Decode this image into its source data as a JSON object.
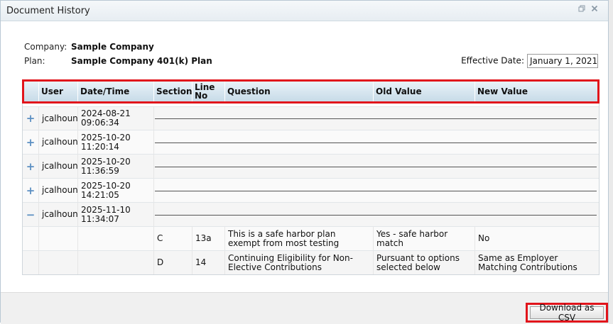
{
  "window": {
    "title": "Document History"
  },
  "info": {
    "company_label": "Company:",
    "company_value": "Sample Company",
    "plan_label": "Plan:",
    "plan_value": "Sample Company 401(k) Plan",
    "effective_date_label": "Effective Date:",
    "effective_date_value": "January 1, 2021"
  },
  "grid": {
    "headers": {
      "user": "User",
      "datetime": "Date/Time",
      "section": "Section",
      "line_no": "Line No",
      "question": "Question",
      "old_value": "Old Value",
      "new_value": "New Value"
    },
    "entries": [
      {
        "expander": "+",
        "user": "jcalhoun",
        "datetime": "2024-08-21 09:06:34"
      },
      {
        "expander": "+",
        "user": "jcalhoun",
        "datetime": "2025-10-20 11:20:14"
      },
      {
        "expander": "+",
        "user": "jcalhoun",
        "datetime": "2025-10-20 11:36:59"
      },
      {
        "expander": "+",
        "user": "jcalhoun",
        "datetime": "2025-10-20 14:21:05"
      },
      {
        "expander": "−",
        "user": "jcalhoun",
        "datetime": "2025-11-10 11:34:07"
      }
    ],
    "details": [
      {
        "section": "C",
        "line_no": "13a",
        "question": "This is a safe harbor plan exempt from most testing",
        "old_value": "Yes - safe harbor match",
        "new_value": "No"
      },
      {
        "section": "D",
        "line_no": "14",
        "question": "Continuing Eligibility for Non-Elective Contributions",
        "old_value": "Pursuant to options selected below",
        "new_value": "Same as Employer Matching Contributions"
      }
    ]
  },
  "footer": {
    "download_label": "Download as CSV"
  },
  "icons": {
    "restore": "restore-icon",
    "close": "close-icon",
    "expand": "plus-icon",
    "collapse": "minus-icon"
  },
  "colors": {
    "highlight": "#e1141b",
    "expander": "#5b8fc2"
  }
}
